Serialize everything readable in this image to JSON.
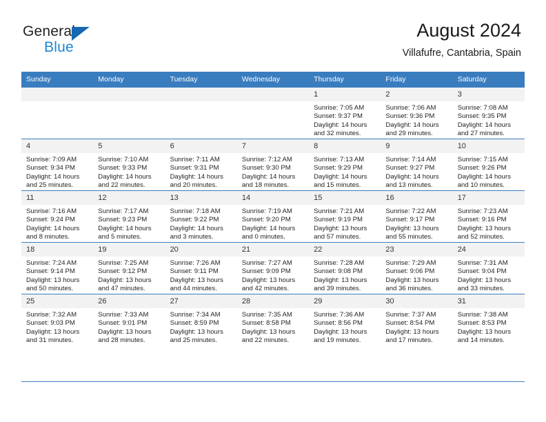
{
  "brand": {
    "name_part1": "General",
    "name_part2": "Blue",
    "triangle_color": "#1668b3",
    "blue_text_color": "#1b85d1"
  },
  "header": {
    "title": "August 2024",
    "location": "Villafufre, Cantabria, Spain"
  },
  "calendar": {
    "header_bg": "#3a7dbf",
    "daynum_bg": "#f2f2f2",
    "weekday_headers": [
      "Sunday",
      "Monday",
      "Tuesday",
      "Wednesday",
      "Thursday",
      "Friday",
      "Saturday"
    ],
    "weeks": [
      [
        {
          "day": "",
          "sunrise": "",
          "sunset": "",
          "daylight_line1": "",
          "daylight_line2": ""
        },
        {
          "day": "",
          "sunrise": "",
          "sunset": "",
          "daylight_line1": "",
          "daylight_line2": ""
        },
        {
          "day": "",
          "sunrise": "",
          "sunset": "",
          "daylight_line1": "",
          "daylight_line2": ""
        },
        {
          "day": "",
          "sunrise": "",
          "sunset": "",
          "daylight_line1": "",
          "daylight_line2": ""
        },
        {
          "day": "1",
          "sunrise": "Sunrise: 7:05 AM",
          "sunset": "Sunset: 9:37 PM",
          "daylight_line1": "Daylight: 14 hours",
          "daylight_line2": "and 32 minutes."
        },
        {
          "day": "2",
          "sunrise": "Sunrise: 7:06 AM",
          "sunset": "Sunset: 9:36 PM",
          "daylight_line1": "Daylight: 14 hours",
          "daylight_line2": "and 29 minutes."
        },
        {
          "day": "3",
          "sunrise": "Sunrise: 7:08 AM",
          "sunset": "Sunset: 9:35 PM",
          "daylight_line1": "Daylight: 14 hours",
          "daylight_line2": "and 27 minutes."
        }
      ],
      [
        {
          "day": "4",
          "sunrise": "Sunrise: 7:09 AM",
          "sunset": "Sunset: 9:34 PM",
          "daylight_line1": "Daylight: 14 hours",
          "daylight_line2": "and 25 minutes."
        },
        {
          "day": "5",
          "sunrise": "Sunrise: 7:10 AM",
          "sunset": "Sunset: 9:33 PM",
          "daylight_line1": "Daylight: 14 hours",
          "daylight_line2": "and 22 minutes."
        },
        {
          "day": "6",
          "sunrise": "Sunrise: 7:11 AM",
          "sunset": "Sunset: 9:31 PM",
          "daylight_line1": "Daylight: 14 hours",
          "daylight_line2": "and 20 minutes."
        },
        {
          "day": "7",
          "sunrise": "Sunrise: 7:12 AM",
          "sunset": "Sunset: 9:30 PM",
          "daylight_line1": "Daylight: 14 hours",
          "daylight_line2": "and 18 minutes."
        },
        {
          "day": "8",
          "sunrise": "Sunrise: 7:13 AM",
          "sunset": "Sunset: 9:29 PM",
          "daylight_line1": "Daylight: 14 hours",
          "daylight_line2": "and 15 minutes."
        },
        {
          "day": "9",
          "sunrise": "Sunrise: 7:14 AM",
          "sunset": "Sunset: 9:27 PM",
          "daylight_line1": "Daylight: 14 hours",
          "daylight_line2": "and 13 minutes."
        },
        {
          "day": "10",
          "sunrise": "Sunrise: 7:15 AM",
          "sunset": "Sunset: 9:26 PM",
          "daylight_line1": "Daylight: 14 hours",
          "daylight_line2": "and 10 minutes."
        }
      ],
      [
        {
          "day": "11",
          "sunrise": "Sunrise: 7:16 AM",
          "sunset": "Sunset: 9:24 PM",
          "daylight_line1": "Daylight: 14 hours",
          "daylight_line2": "and 8 minutes."
        },
        {
          "day": "12",
          "sunrise": "Sunrise: 7:17 AM",
          "sunset": "Sunset: 9:23 PM",
          "daylight_line1": "Daylight: 14 hours",
          "daylight_line2": "and 5 minutes."
        },
        {
          "day": "13",
          "sunrise": "Sunrise: 7:18 AM",
          "sunset": "Sunset: 9:22 PM",
          "daylight_line1": "Daylight: 14 hours",
          "daylight_line2": "and 3 minutes."
        },
        {
          "day": "14",
          "sunrise": "Sunrise: 7:19 AM",
          "sunset": "Sunset: 9:20 PM",
          "daylight_line1": "Daylight: 14 hours",
          "daylight_line2": "and 0 minutes."
        },
        {
          "day": "15",
          "sunrise": "Sunrise: 7:21 AM",
          "sunset": "Sunset: 9:19 PM",
          "daylight_line1": "Daylight: 13 hours",
          "daylight_line2": "and 57 minutes."
        },
        {
          "day": "16",
          "sunrise": "Sunrise: 7:22 AM",
          "sunset": "Sunset: 9:17 PM",
          "daylight_line1": "Daylight: 13 hours",
          "daylight_line2": "and 55 minutes."
        },
        {
          "day": "17",
          "sunrise": "Sunrise: 7:23 AM",
          "sunset": "Sunset: 9:16 PM",
          "daylight_line1": "Daylight: 13 hours",
          "daylight_line2": "and 52 minutes."
        }
      ],
      [
        {
          "day": "18",
          "sunrise": "Sunrise: 7:24 AM",
          "sunset": "Sunset: 9:14 PM",
          "daylight_line1": "Daylight: 13 hours",
          "daylight_line2": "and 50 minutes."
        },
        {
          "day": "19",
          "sunrise": "Sunrise: 7:25 AM",
          "sunset": "Sunset: 9:12 PM",
          "daylight_line1": "Daylight: 13 hours",
          "daylight_line2": "and 47 minutes."
        },
        {
          "day": "20",
          "sunrise": "Sunrise: 7:26 AM",
          "sunset": "Sunset: 9:11 PM",
          "daylight_line1": "Daylight: 13 hours",
          "daylight_line2": "and 44 minutes."
        },
        {
          "day": "21",
          "sunrise": "Sunrise: 7:27 AM",
          "sunset": "Sunset: 9:09 PM",
          "daylight_line1": "Daylight: 13 hours",
          "daylight_line2": "and 42 minutes."
        },
        {
          "day": "22",
          "sunrise": "Sunrise: 7:28 AM",
          "sunset": "Sunset: 9:08 PM",
          "daylight_line1": "Daylight: 13 hours",
          "daylight_line2": "and 39 minutes."
        },
        {
          "day": "23",
          "sunrise": "Sunrise: 7:29 AM",
          "sunset": "Sunset: 9:06 PM",
          "daylight_line1": "Daylight: 13 hours",
          "daylight_line2": "and 36 minutes."
        },
        {
          "day": "24",
          "sunrise": "Sunrise: 7:31 AM",
          "sunset": "Sunset: 9:04 PM",
          "daylight_line1": "Daylight: 13 hours",
          "daylight_line2": "and 33 minutes."
        }
      ],
      [
        {
          "day": "25",
          "sunrise": "Sunrise: 7:32 AM",
          "sunset": "Sunset: 9:03 PM",
          "daylight_line1": "Daylight: 13 hours",
          "daylight_line2": "and 31 minutes."
        },
        {
          "day": "26",
          "sunrise": "Sunrise: 7:33 AM",
          "sunset": "Sunset: 9:01 PM",
          "daylight_line1": "Daylight: 13 hours",
          "daylight_line2": "and 28 minutes."
        },
        {
          "day": "27",
          "sunrise": "Sunrise: 7:34 AM",
          "sunset": "Sunset: 8:59 PM",
          "daylight_line1": "Daylight: 13 hours",
          "daylight_line2": "and 25 minutes."
        },
        {
          "day": "28",
          "sunrise": "Sunrise: 7:35 AM",
          "sunset": "Sunset: 8:58 PM",
          "daylight_line1": "Daylight: 13 hours",
          "daylight_line2": "and 22 minutes."
        },
        {
          "day": "29",
          "sunrise": "Sunrise: 7:36 AM",
          "sunset": "Sunset: 8:56 PM",
          "daylight_line1": "Daylight: 13 hours",
          "daylight_line2": "and 19 minutes."
        },
        {
          "day": "30",
          "sunrise": "Sunrise: 7:37 AM",
          "sunset": "Sunset: 8:54 PM",
          "daylight_line1": "Daylight: 13 hours",
          "daylight_line2": "and 17 minutes."
        },
        {
          "day": "31",
          "sunrise": "Sunrise: 7:38 AM",
          "sunset": "Sunset: 8:53 PM",
          "daylight_line1": "Daylight: 13 hours",
          "daylight_line2": "and 14 minutes."
        }
      ]
    ]
  }
}
